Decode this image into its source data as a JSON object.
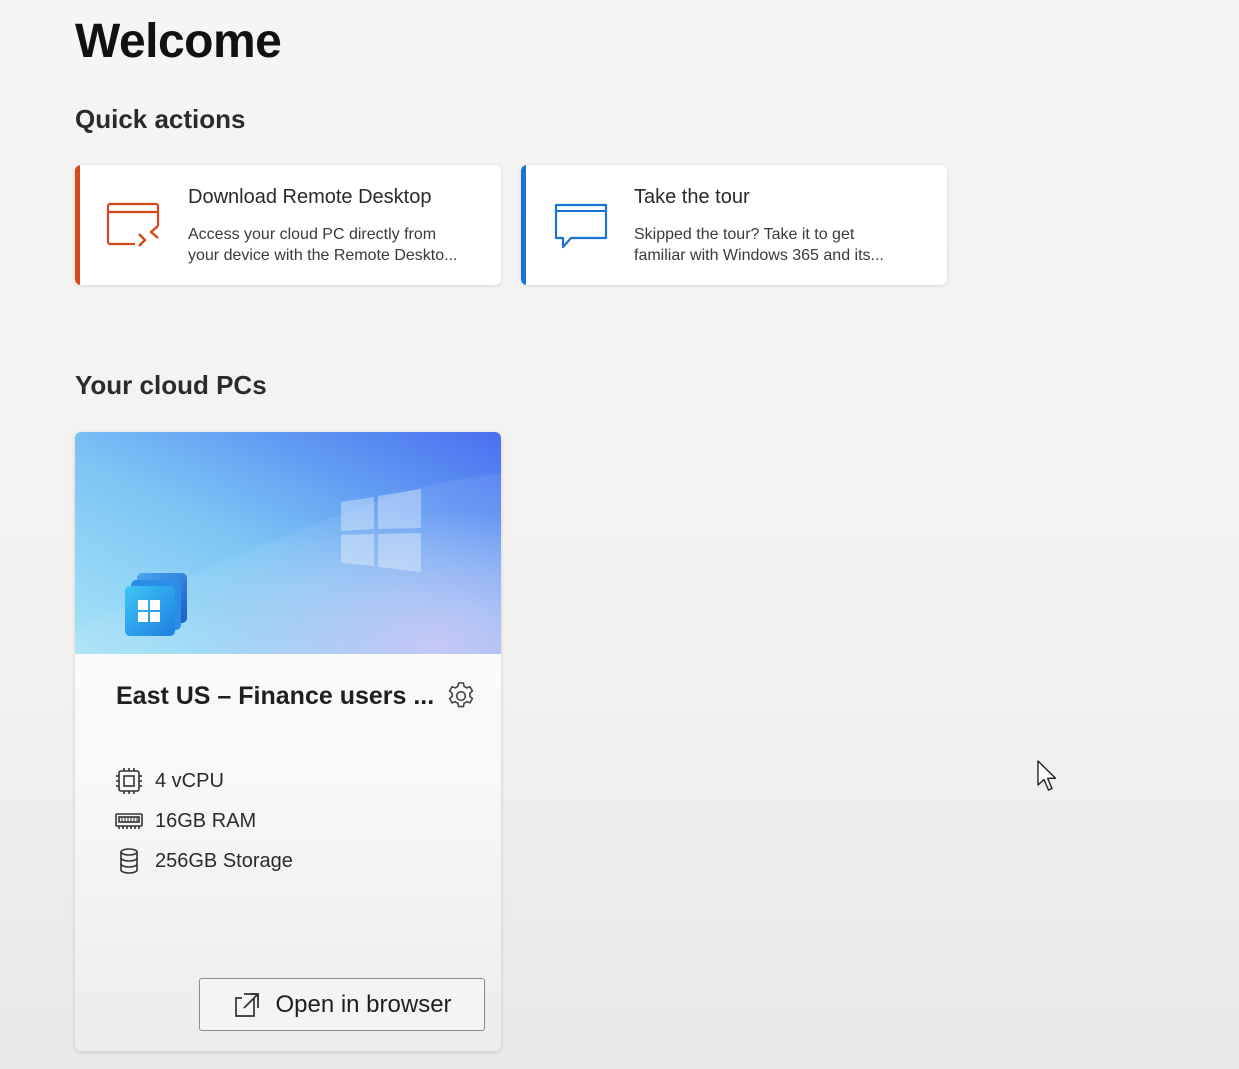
{
  "page": {
    "title": "Welcome"
  },
  "quick_actions": {
    "heading": "Quick actions",
    "cards": [
      {
        "title": "Download Remote Desktop",
        "description_line1": "Access your cloud PC directly from",
        "description_line2": "your device with the Remote Deskto...",
        "accent_color": "#d9471a",
        "icon": "remote-desktop-icon"
      },
      {
        "title": "Take the tour",
        "description_line1": "Skipped the tour? Take it to get",
        "description_line2": "familiar with Windows 365 and its...",
        "accent_color": "#1a73d9",
        "icon": "chat-bubble-icon"
      }
    ]
  },
  "cloud_pcs": {
    "heading": "Your cloud PCs",
    "items": [
      {
        "name": "East US – Finance users ...",
        "specs": [
          {
            "label": "4 vCPU",
            "icon": "cpu-icon"
          },
          {
            "label": "16GB RAM",
            "icon": "ram-icon"
          },
          {
            "label": "256GB Storage",
            "icon": "storage-icon"
          }
        ],
        "settings_icon": "gear-icon",
        "open_button_label": "Open in browser",
        "open_button_icon": "open-external-icon"
      }
    ]
  },
  "colors": {
    "background": "#f3f2f1",
    "download_accent": "#d9471a",
    "tour_accent": "#1a73d9"
  }
}
